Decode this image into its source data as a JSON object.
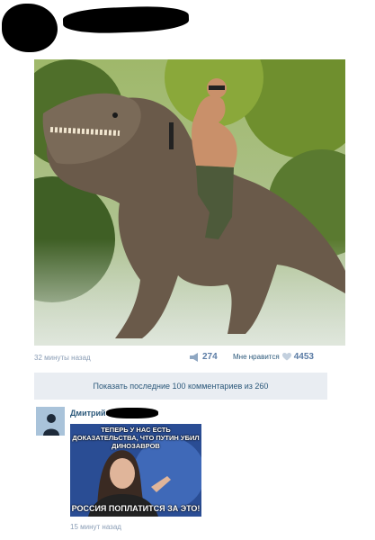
{
  "post": {
    "time": "32 минуты назад",
    "reposts": "274",
    "likes_label": "Мне нравится",
    "likes": "4453"
  },
  "comments_bar": {
    "label": "Показать последние 100 комментариев из 260"
  },
  "comment": {
    "author": "Дмитрий",
    "meme_top": "ТЕПЕРЬ У НАС ЕСТЬ ДОКАЗАТЕЛЬСТВА, ЧТО ПУТИН УБИЛ ДИНОЗАВРОВ",
    "meme_bottom": "РОССИЯ ПОПЛАТИТСЯ ЗА ЭТО!",
    "time": "15 минут назад"
  },
  "icons": {
    "repost": "megaphone-icon",
    "like": "heart-icon"
  },
  "colors": {
    "link": "#2b587a",
    "meta": "#8a9db5",
    "bar_bg": "#e9edf2"
  }
}
